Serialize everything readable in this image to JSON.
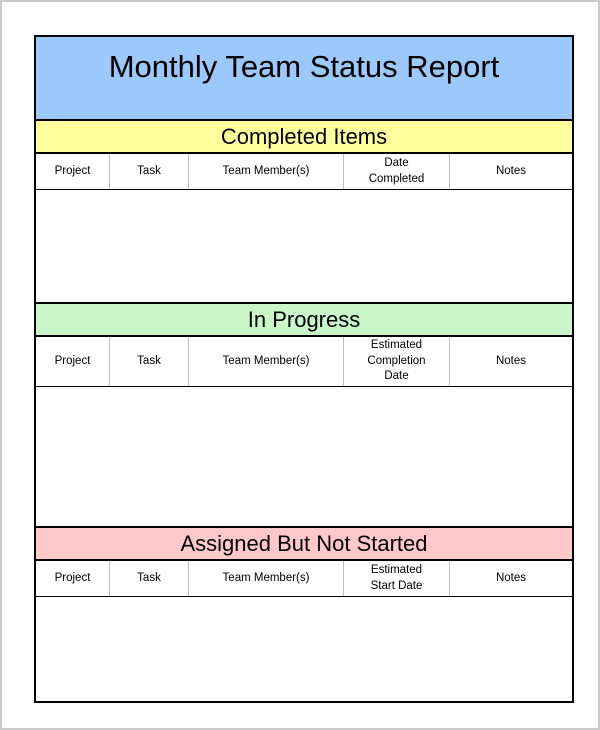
{
  "document": {
    "title": "Monthly Team Status Report",
    "colors": {
      "title_band": "#9cc9fb",
      "completed_band": "#ffff9e",
      "in_progress_band": "#caf7c9",
      "assigned_band": "#ffc9c9",
      "border": "#000000",
      "column_divider": "#bdbdbd",
      "page_edge": "#c9c9c9"
    }
  },
  "sections": [
    {
      "id": "completed-items",
      "heading": "Completed Items",
      "band_color": "#ffff9e",
      "columns": [
        {
          "label": "Project",
          "key": "project"
        },
        {
          "label": "Task",
          "key": "task"
        },
        {
          "label": "Team Member(s)",
          "key": "team_members"
        },
        {
          "label": "Date\nCompleted",
          "key": "date_completed"
        },
        {
          "label": "Notes",
          "key": "notes"
        }
      ],
      "rows": []
    },
    {
      "id": "in-progress",
      "heading": "In Progress",
      "band_color": "#caf7c9",
      "columns": [
        {
          "label": "Project",
          "key": "project"
        },
        {
          "label": "Task",
          "key": "task"
        },
        {
          "label": "Team Member(s)",
          "key": "team_members"
        },
        {
          "label": "Estimated\nCompletion\nDate",
          "key": "estimated_completion_date"
        },
        {
          "label": "Notes",
          "key": "notes"
        }
      ],
      "rows": []
    },
    {
      "id": "assigned-but-not-started",
      "heading": "Assigned But Not Started",
      "band_color": "#ffc9c9",
      "columns": [
        {
          "label": "Project",
          "key": "project"
        },
        {
          "label": "Task",
          "key": "task"
        },
        {
          "label": "Team Member(s)",
          "key": "team_members"
        },
        {
          "label": "Estimated\nStart Date",
          "key": "estimated_start_date"
        },
        {
          "label": "Notes",
          "key": "notes"
        }
      ],
      "rows": []
    }
  ]
}
